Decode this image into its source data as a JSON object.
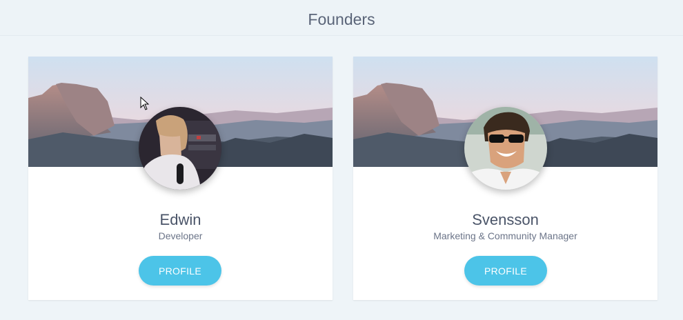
{
  "page": {
    "title": "Founders"
  },
  "founders": [
    {
      "name": "Edwin",
      "role": "Developer",
      "button_label": "PROFILE",
      "avatar": "avatar-photo"
    },
    {
      "name": "Svensson",
      "role": "Marketing & Community Manager",
      "button_label": "PROFILE",
      "avatar": "avatar-photo"
    }
  ],
  "colors": {
    "background": "#eef4f8",
    "card": "#ffffff",
    "button": "#4cc4e8",
    "title_text": "#5a6478"
  },
  "icons": {
    "cursor": "mouse-pointer-icon"
  }
}
